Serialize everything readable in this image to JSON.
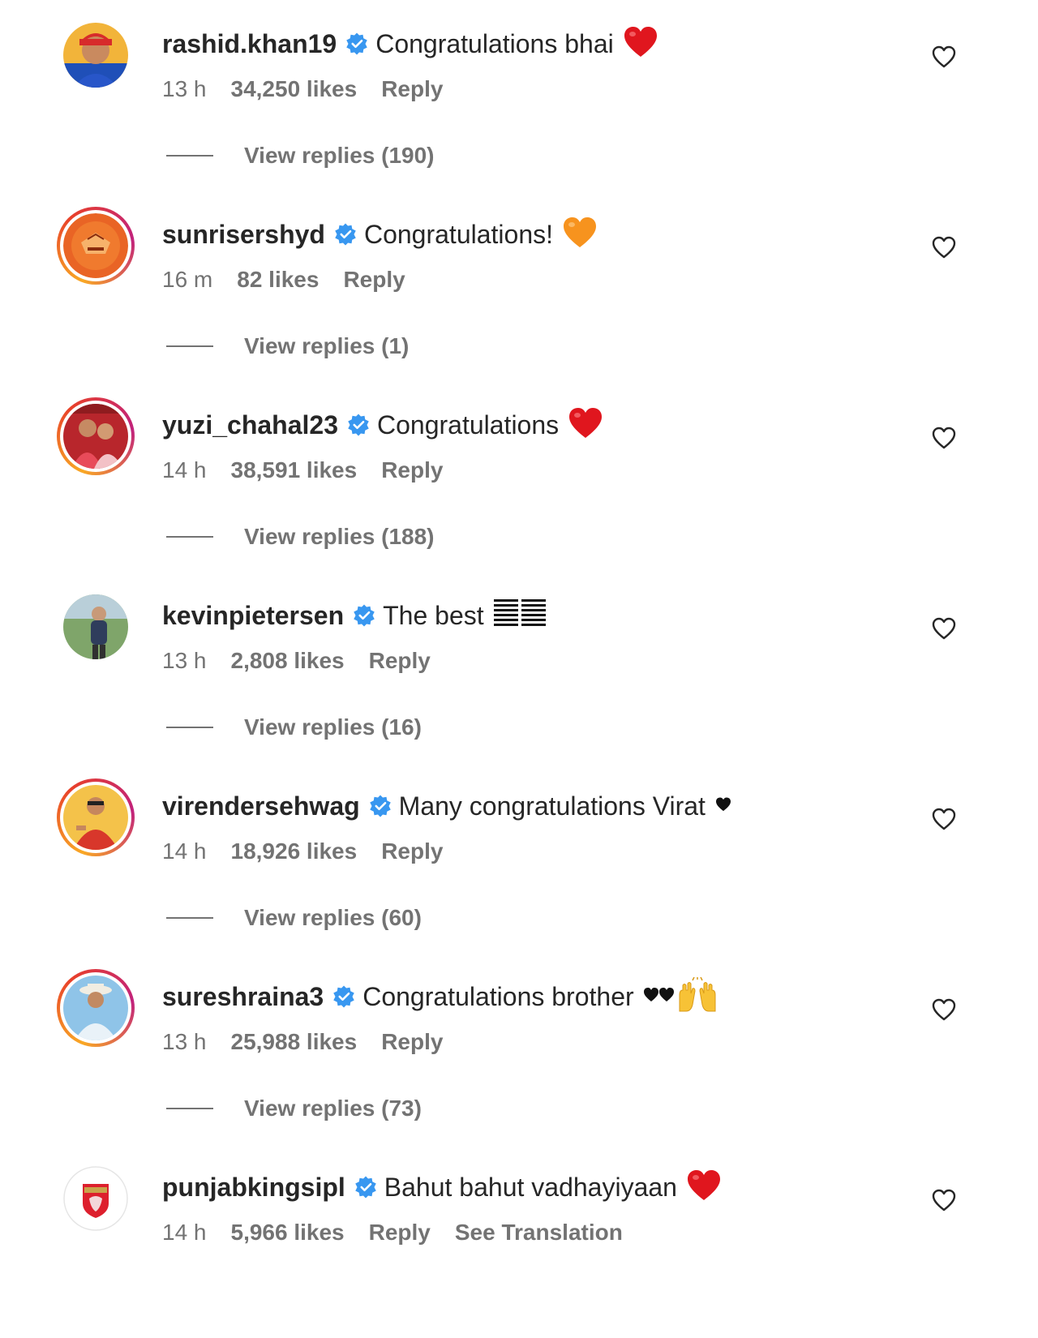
{
  "comments": [
    {
      "username": "rashid.khan19",
      "text": "Congratulations bhai",
      "emoji": "red-heart",
      "time": "13 h",
      "likes": "34,250 likes",
      "reply": "Reply",
      "view_replies": "View replies (190)",
      "avatar": "rashid-avatar",
      "story_ring": false
    },
    {
      "username": "sunrisershyd",
      "text": "Congratulations!",
      "emoji": "orange-heart",
      "time": "16 m",
      "likes": "82 likes",
      "reply": "Reply",
      "view_replies": "View replies (1)",
      "avatar": "sunrisers-logo-avatar",
      "story_ring": true
    },
    {
      "username": "yuzi_chahal23",
      "text": "Congratulations",
      "emoji": "red-heart",
      "time": "14 h",
      "likes": "38,591 likes",
      "reply": "Reply",
      "view_replies": "View replies (188)",
      "avatar": "yuzi-avatar",
      "story_ring": true
    },
    {
      "username": "kevinpietersen",
      "text": "The best",
      "emoji": "flag-stripes",
      "time": "13 h",
      "likes": "2,808 likes",
      "reply": "Reply",
      "view_replies": "View replies (16)",
      "avatar": "kevin-avatar",
      "story_ring": false
    },
    {
      "username": "virendersehwag",
      "text": "Many congratulations Virat",
      "emoji": "small-black-heart",
      "time": "14 h",
      "likes": "18,926 likes",
      "reply": "Reply",
      "view_replies": "View replies (60)",
      "avatar": "virender-avatar",
      "story_ring": true
    },
    {
      "username": "sureshraina3",
      "text": "Congratulations brother",
      "emoji": "two-black-hearts-raised-hands",
      "time": "13 h",
      "likes": "25,988 likes",
      "reply": "Reply",
      "view_replies": "View replies (73)",
      "avatar": "suresh-avatar",
      "story_ring": true
    },
    {
      "username": "punjabkingsipl",
      "text": "Bahut bahut vadhayiyaan",
      "emoji": "red-heart",
      "time": "14 h",
      "likes": "5,966 likes",
      "reply": "Reply",
      "see_translation": "See Translation",
      "avatar": "punjab-kings-logo-avatar",
      "story_ring": false
    }
  ],
  "colors": {
    "verified_blue": "#3897f0",
    "secondary_text": "#737373",
    "primary_text": "#262626",
    "red_heart": "#e0161e",
    "orange_heart": "#f7931e"
  }
}
